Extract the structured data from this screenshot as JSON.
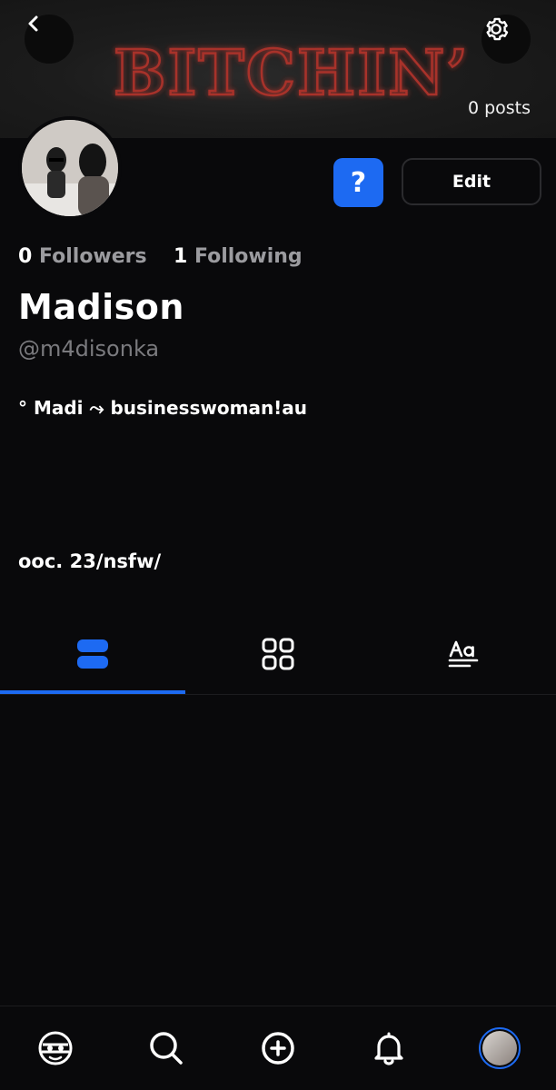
{
  "banner": {
    "title": "BITCHIN’"
  },
  "header": {
    "post_count": "0 posts"
  },
  "actions": {
    "help_label": "?",
    "edit_label": "Edit"
  },
  "stats": {
    "followers_count": "0",
    "followers_label": "Followers",
    "following_count": "1",
    "following_label": "Following"
  },
  "profile": {
    "display_name": "Madison",
    "handle": "@m4disonka",
    "bio_line1": "° Madi  ⤳ businesswoman!au",
    "bio_line2": "ooc. 23/nsfw/"
  },
  "tabs": [
    {
      "name": "posts",
      "icon": "list-icon",
      "active": true
    },
    {
      "name": "grid",
      "icon": "grid-icon",
      "active": false
    },
    {
      "name": "text",
      "icon": "text-format-icon",
      "active": false
    }
  ],
  "bottom_nav": [
    {
      "name": "home",
      "icon": "home-logo-icon"
    },
    {
      "name": "search",
      "icon": "search-icon"
    },
    {
      "name": "create",
      "icon": "plus-circle-icon"
    },
    {
      "name": "notifications",
      "icon": "bell-icon"
    },
    {
      "name": "profile",
      "icon": "avatar"
    }
  ],
  "colors": {
    "accent": "#1d6af2",
    "background": "#09090b",
    "banner_neon": "#b0332c",
    "muted_text": "#9b9b9f"
  }
}
